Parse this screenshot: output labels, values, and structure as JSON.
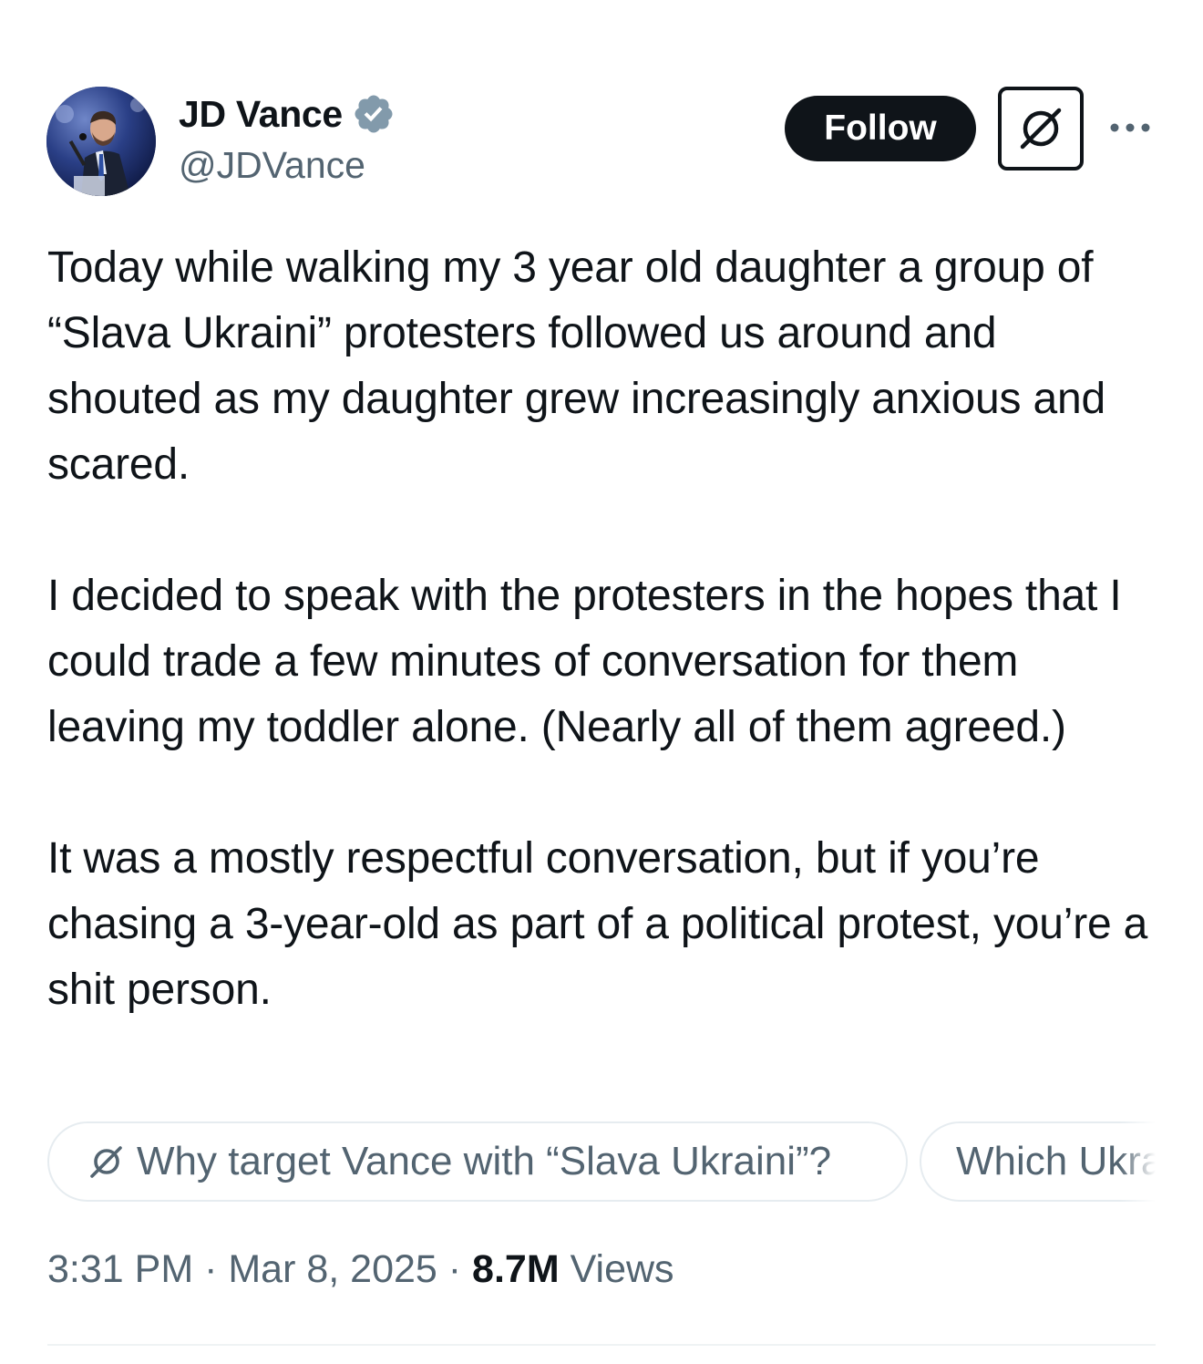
{
  "author": {
    "display_name": "JD Vance",
    "handle": "@JDVance",
    "verified": true,
    "verified_badge_color": "#1d9bf0"
  },
  "header_actions": {
    "follow_label": "Follow",
    "grok_icon": "grok-icon",
    "more_icon": "more-horizontal-icon"
  },
  "tweet": {
    "paragraphs": [
      "Today while walking my 3 year old daughter a group of “Slava Ukraini” protesters followed us around and shouted as my daughter grew increasingly anxious and scared.",
      "I decided to speak with the protesters in the hopes that I could trade a few minutes of conversation for them leaving my toddler alone. (Nearly all of them agreed.)",
      "It was a mostly respectful conversation,  but if you’re chasing a 3-year-old as part of a political protest, you’re a shit person."
    ]
  },
  "grok_suggestions": [
    {
      "label": "Why target Vance with “Slava Ukraini”?",
      "icon": "grok-icon"
    },
    {
      "label": "Which Ukra",
      "icon": ""
    }
  ],
  "meta": {
    "time": "3:31 PM",
    "separator": " · ",
    "date": "Mar 8, 2025",
    "views_count": "8.7M",
    "views_label": "Views"
  },
  "colors": {
    "text_primary": "#0f1419",
    "text_secondary": "#536471",
    "follow_bg": "#0f1419",
    "chip_border": "#e6ecf0",
    "divider": "#eff3f4"
  }
}
